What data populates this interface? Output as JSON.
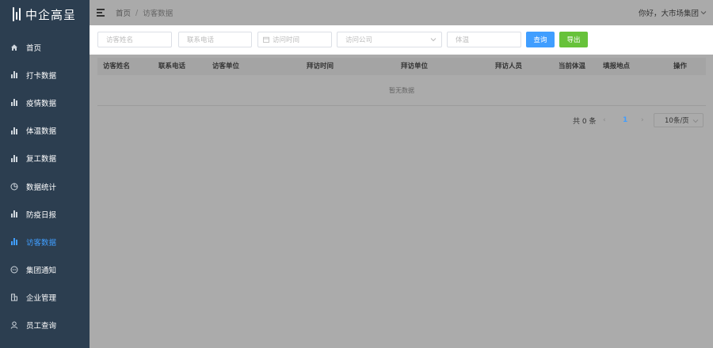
{
  "brand": {
    "name": "中企高呈"
  },
  "sidebar": {
    "items": [
      {
        "label": "首页",
        "icon": "home-icon"
      },
      {
        "label": "打卡数据",
        "icon": "bar-chart-icon"
      },
      {
        "label": "疫情数据",
        "icon": "bar-chart-icon"
      },
      {
        "label": "体温数据",
        "icon": "bar-chart-icon"
      },
      {
        "label": "复工数据",
        "icon": "bar-chart-icon"
      },
      {
        "label": "数据统计",
        "icon": "pie-chart-icon"
      },
      {
        "label": "防疫日报",
        "icon": "bar-chart-icon"
      },
      {
        "label": "访客数据",
        "icon": "bar-chart-icon",
        "active": true
      },
      {
        "label": "集团通知",
        "icon": "chat-icon"
      },
      {
        "label": "企业管理",
        "icon": "building-icon"
      },
      {
        "label": "员工查询",
        "icon": "user-icon"
      }
    ],
    "active_color": "#409eff",
    "background": "#2c3e50"
  },
  "header": {
    "breadcrumb": [
      "首页",
      "访客数据"
    ],
    "separator": "/",
    "greeting": "你好，大市场集团"
  },
  "filters": {
    "visitor_name_placeholder": "访客姓名",
    "phone_placeholder": "联系电话",
    "visit_time_placeholder": "访问时间",
    "company_placeholder": "访问公司",
    "temperature_placeholder": "体温",
    "query_label": "查询",
    "export_label": "导出"
  },
  "table": {
    "columns": [
      "访客姓名",
      "联系电话",
      "访客单位",
      "拜访时间",
      "拜访单位",
      "拜访人员",
      "当前体温",
      "填报地点",
      "操作"
    ],
    "rows": [],
    "empty_text": "暂无数据"
  },
  "pagination": {
    "total_text": "共 0 条",
    "current_page": "1",
    "page_size": "10条/页",
    "prev": "‹",
    "next": "›"
  }
}
